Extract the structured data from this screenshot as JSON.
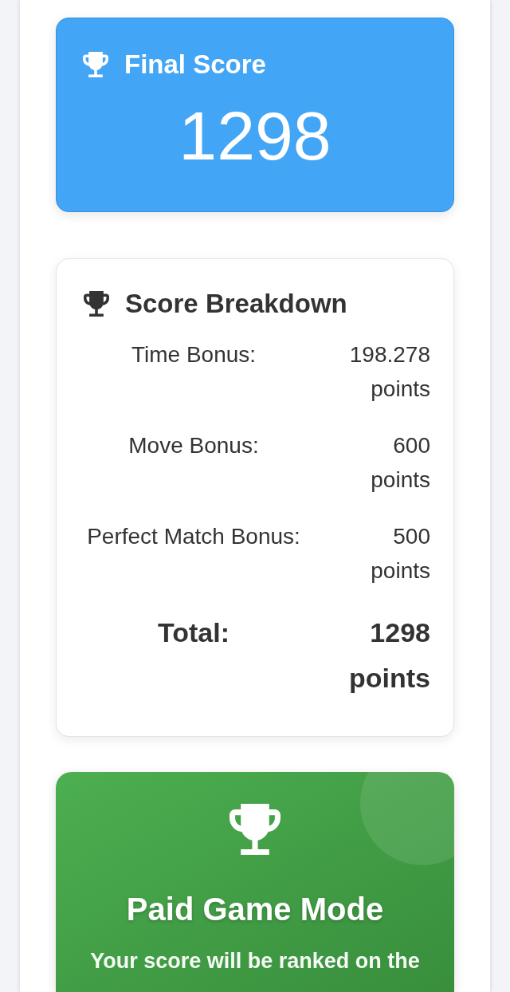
{
  "final_score": {
    "title": "Final Score",
    "value": "1298"
  },
  "breakdown": {
    "title": "Score Breakdown",
    "rows": [
      {
        "kind": "bonus",
        "label": "Time Bonus:",
        "value": "198.278 points"
      },
      {
        "kind": "bonus",
        "label": "Move Bonus:",
        "value": "600 points"
      },
      {
        "kind": "bonus",
        "label": "Perfect Match Bonus:",
        "value": "500 points"
      },
      {
        "kind": "total",
        "label": "Total:",
        "value": "1298 points"
      }
    ]
  },
  "paid_mode": {
    "title": "Paid Game Mode",
    "message": "Your score will be ranked on the"
  }
}
